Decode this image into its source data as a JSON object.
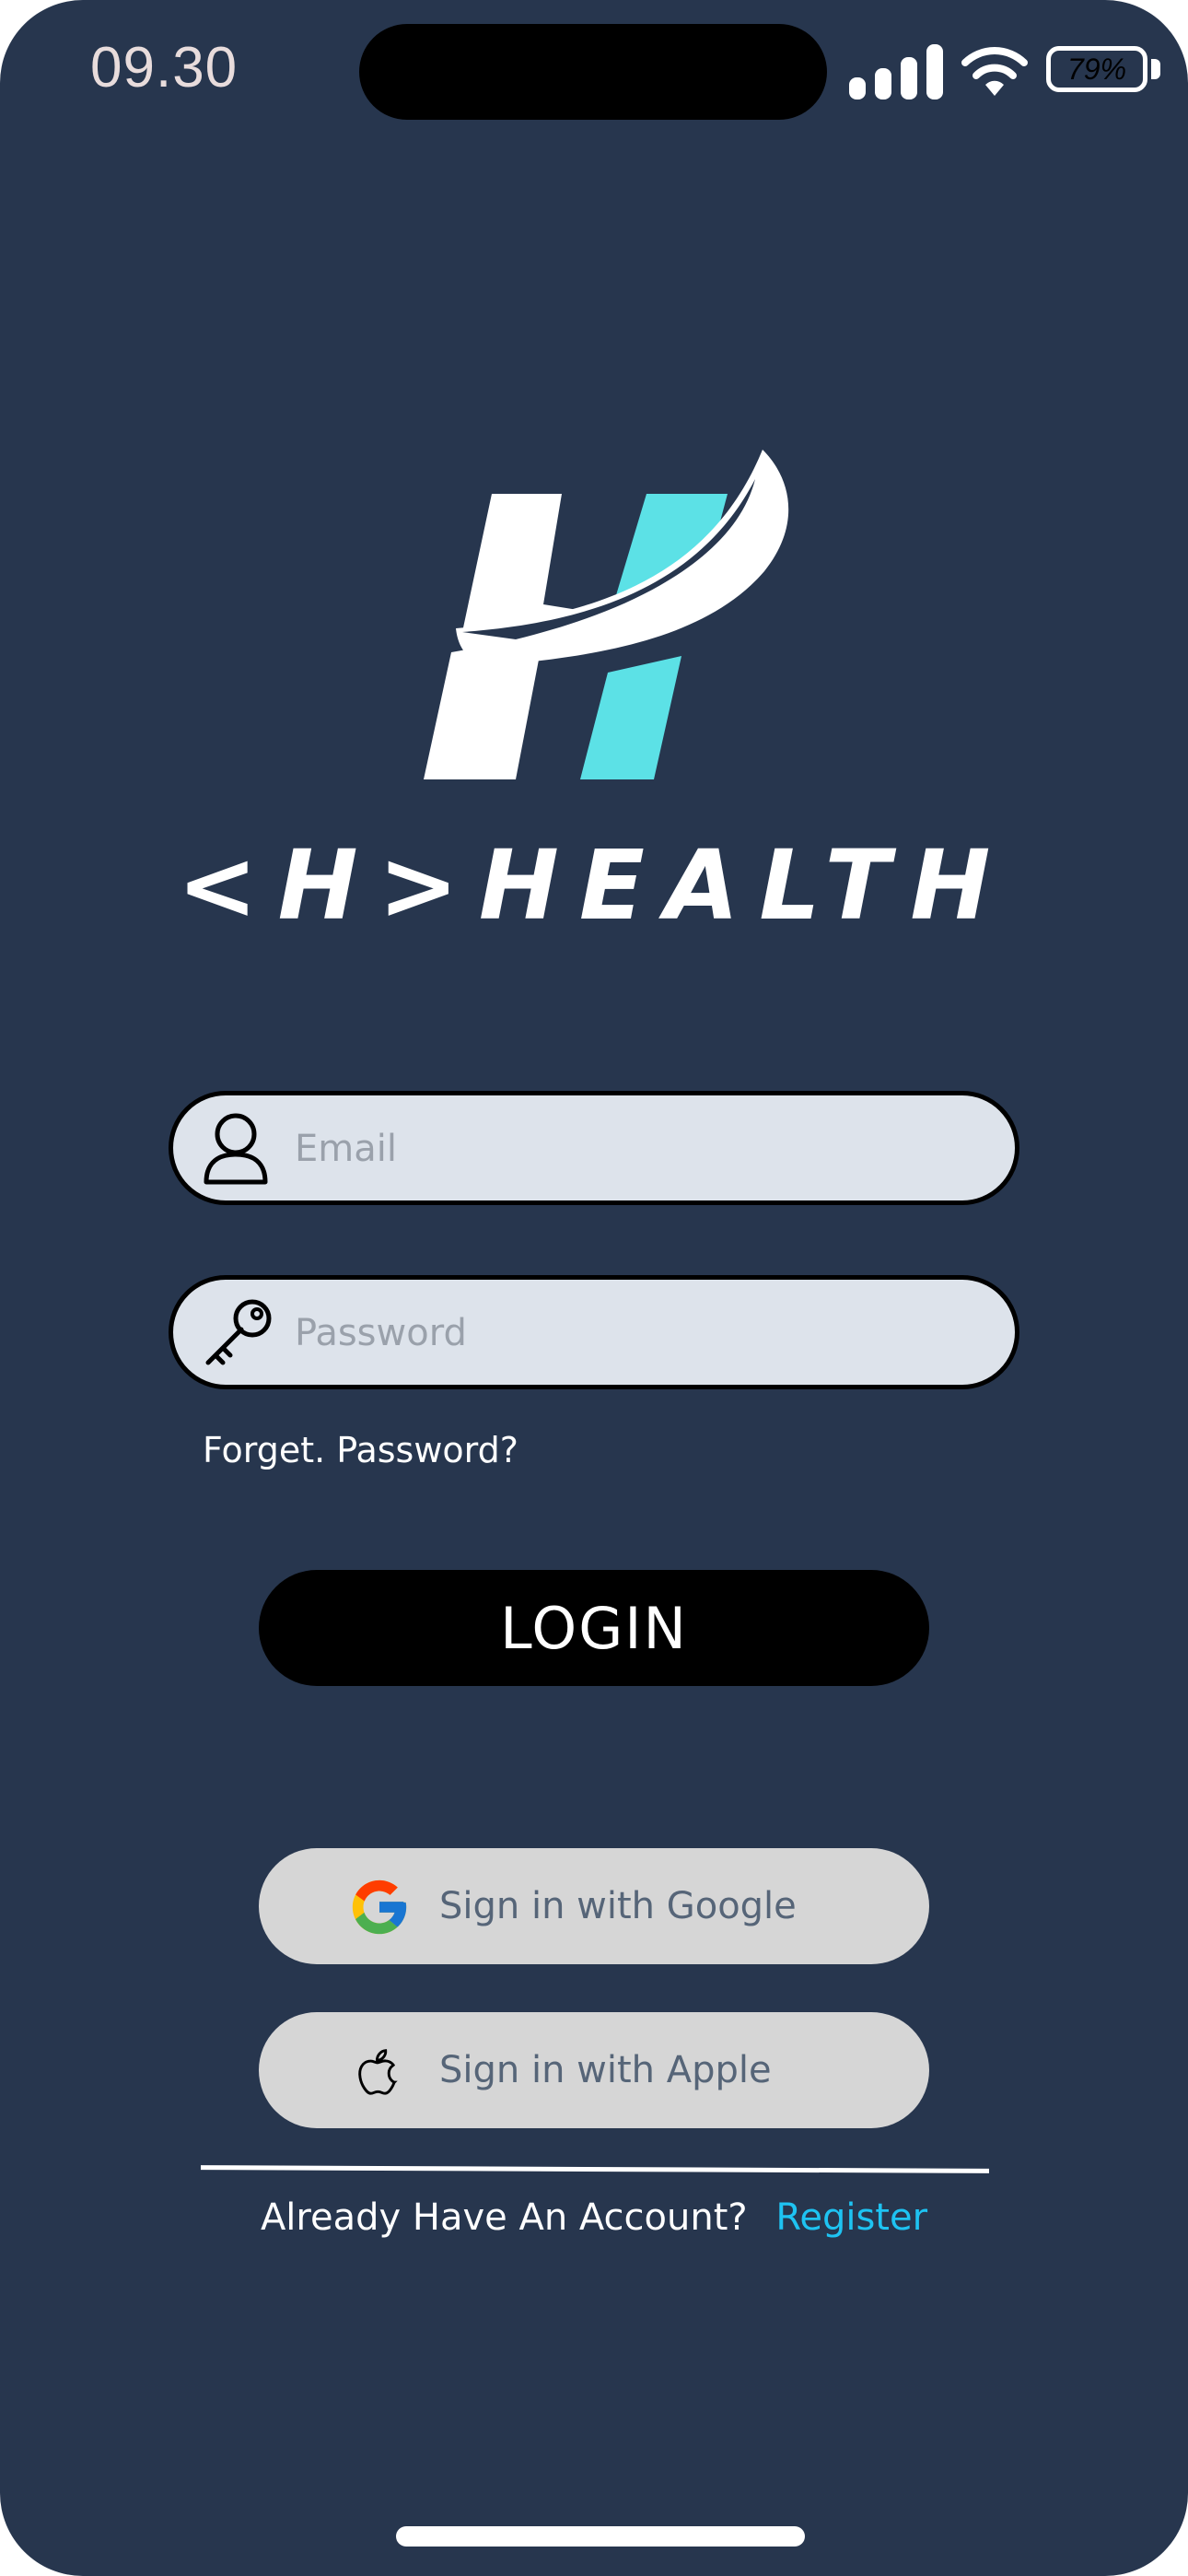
{
  "status_bar": {
    "time": "09.30",
    "battery": "79%",
    "battery_level": 0.79
  },
  "brand": {
    "wordmark": "<H>HEALTH",
    "primary_color": "#27364e",
    "accent_color": "#5ce1e6"
  },
  "form": {
    "email": {
      "value": "",
      "placeholder": "Email",
      "icon": "user-icon"
    },
    "password": {
      "value": "",
      "placeholder": "Password",
      "icon": "key-icon"
    },
    "forgot_label": "Forget. Password?",
    "login_label": "LOGIN"
  },
  "social": {
    "google_label": "Sign in with Google",
    "google_icon": "google-icon",
    "apple_label": "Sign in with Apple",
    "apple_icon": "apple-icon"
  },
  "footer": {
    "prompt": "Already Have An Account?",
    "register_label": "Register",
    "register_color": "#1ec3f2"
  }
}
